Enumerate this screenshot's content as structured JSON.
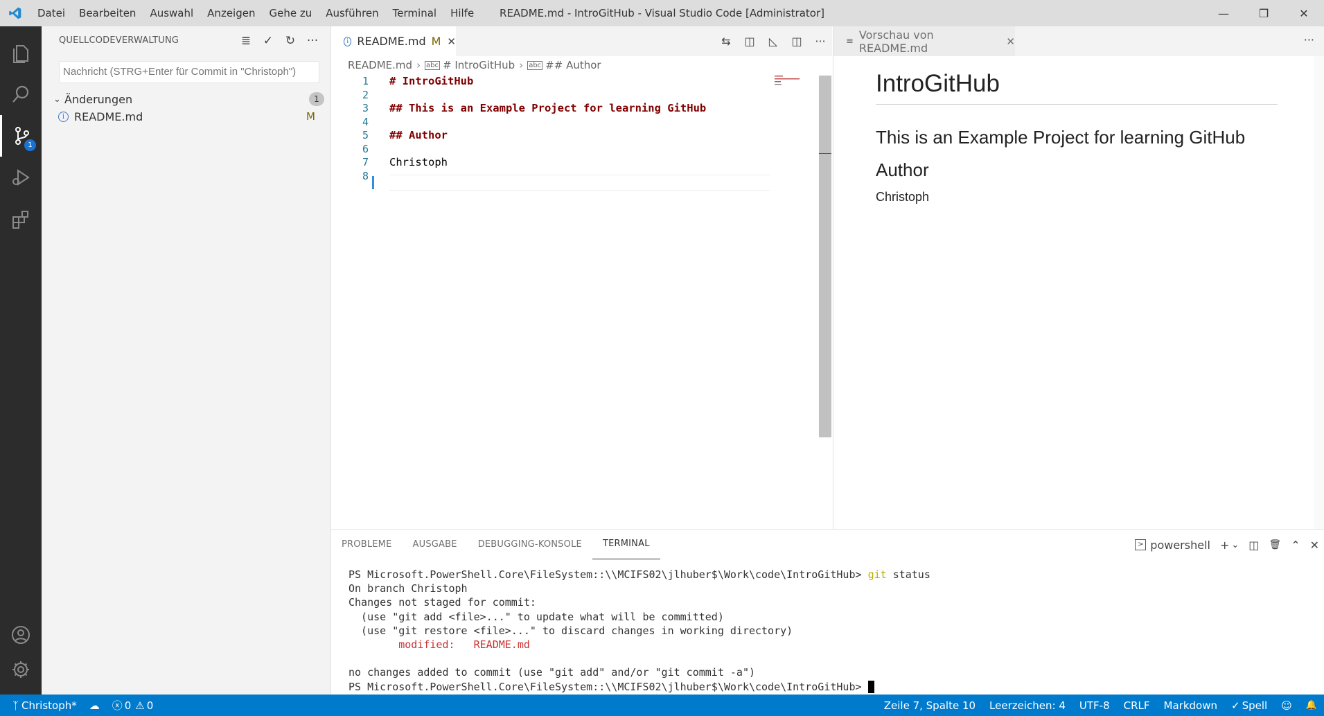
{
  "window": {
    "title": "README.md - IntroGitHub - Visual Studio Code [Administrator]",
    "menu": [
      "Datei",
      "Bearbeiten",
      "Auswahl",
      "Anzeigen",
      "Gehe zu",
      "Ausführen",
      "Terminal",
      "Hilfe"
    ],
    "controls": {
      "minimize": "—",
      "restore": "❐",
      "close": "✕"
    }
  },
  "activity_bar": {
    "items": [
      "explorer-icon",
      "search-icon",
      "source-control-icon",
      "run-debug-icon",
      "extensions-icon",
      "accounts-icon",
      "manage-gear-icon"
    ],
    "scm_badge": "1"
  },
  "sidebar": {
    "title": "QUELLCODEVERWALTUNG",
    "actions": {
      "view": "≣",
      "commit": "✓",
      "refresh": "↻",
      "more": "···"
    },
    "commit_placeholder": "Nachricht (STRG+Enter für Commit in \"Christoph\")",
    "changes_label": "Änderungen",
    "changes_count": "1",
    "files": [
      {
        "name": "README.md",
        "status": "M"
      }
    ]
  },
  "editor": {
    "tab": {
      "label": "README.md",
      "modified": "M",
      "close": "✕"
    },
    "actions": {
      "compare": "⇆",
      "preview": "◫",
      "toggle": "◺",
      "split": "◫",
      "more": "···"
    },
    "breadcrumb": {
      "file": "README.md",
      "sym1": "# IntroGitHub",
      "sym2": "## Author",
      "sym_icon": "abc"
    },
    "lines": [
      {
        "n": "1",
        "text": "# IntroGitHub"
      },
      {
        "n": "2",
        "text": ""
      },
      {
        "n": "3",
        "text": "## This is an Example Project for learning GitHub"
      },
      {
        "n": "4",
        "text": ""
      },
      {
        "n": "5",
        "text": "## Author"
      },
      {
        "n": "6",
        "text": ""
      },
      {
        "n": "7",
        "text": "Christoph"
      },
      {
        "n": "8",
        "text": ""
      }
    ]
  },
  "preview": {
    "tab": {
      "label": "Vorschau von README.md",
      "close": "✕"
    },
    "more": "···",
    "h1": "IntroGitHub",
    "h2a": "This is an Example Project for learning GitHub",
    "h2b": "Author",
    "p": "Christoph"
  },
  "panel": {
    "tabs": [
      "PROBLEME",
      "AUSGABE",
      "DEBUGGING-KONSOLE",
      "TERMINAL"
    ],
    "active_tab": "TERMINAL",
    "shell": "powershell",
    "actions": {
      "add": "+",
      "dropdown": "⌄",
      "split": "◫",
      "trash": "🗑",
      "maximize": "⌃",
      "close": "✕"
    },
    "terminal": {
      "prompt": "PS Microsoft.PowerShell.Core\\FileSystem::\\\\MCIFS02\\jlhuber$\\Work\\code\\IntroGitHub>",
      "cmd_git": "git",
      "cmd_rest": "status",
      "out1": "On branch Christoph",
      "out2": "Changes not staged for commit:",
      "out3": "  (use \"git add <file>...\" to update what will be committed)",
      "out4": "  (use \"git restore <file>...\" to discard changes in working directory)",
      "mod_label": "modified:",
      "mod_file": "README.md",
      "out6": "no changes added to commit (use \"git add\" and/or \"git commit -a\")"
    }
  },
  "status_bar": {
    "branch": "Christoph*",
    "sync": "☁",
    "errors": "0",
    "warnings": "0",
    "position": "Zeile 7, Spalte 10",
    "indent": "Leerzeichen: 4",
    "encoding": "UTF-8",
    "eol": "CRLF",
    "language": "Markdown",
    "spell": "Spell",
    "feedback": "☺",
    "bell": "🔔"
  },
  "colors": {
    "accent": "#007acc",
    "activity_bar": "#2c2c2c",
    "sidebar": "#f3f3f3",
    "md_heading": "#800000",
    "line_numbers": "#237893",
    "term_red": "#cd3131",
    "term_yellow": "#bcae00"
  }
}
